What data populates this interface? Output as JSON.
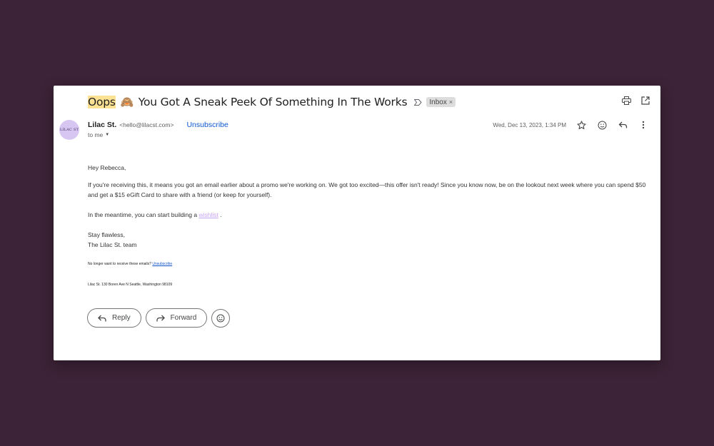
{
  "email": {
    "subject_highlight": "Oops",
    "subject_emoji": "🙈",
    "subject_rest": "You Got A Sneak Peek Of Something In The Works",
    "label": "Inbox",
    "sender_name": "Lilac St.",
    "sender_email": "<hello@lilacst.com>",
    "unsubscribe_label": "Unsubscribe",
    "to_label": "to me",
    "date": "Wed, Dec 13, 2023, 1:34 PM",
    "avatar_text": "LILAC ST"
  },
  "body": {
    "greeting": "Hey Rebecca,",
    "paragraph1": "If you're receiving this, it means you got an email earlier about a promo we're working on. We got too excited—this offer isn't ready! Since you know now, be on the lookout next week where you can spend $50 and get a $15 eGift Card to share with a friend (or keep for yourself).",
    "paragraph2_before": "In the meantime, you can start building a",
    "wishlist_link": "wishlist",
    "paragraph2_after": ".",
    "signoff1": "Stay flawless,",
    "signoff2": "The Lilac St. team",
    "footer_text": "No longer want to receive these emails?",
    "footer_link": "Unsubscribe",
    "address": "Lilac St. 130 Boren Ave N Seattle, Washington 98109"
  },
  "actions": {
    "reply_label": "Reply",
    "forward_label": "Forward"
  },
  "colors": {
    "background": "#3c2337",
    "highlight": "#fde293",
    "link_blue": "#0b57d0",
    "wishlist_lilac": "#c9a3f0",
    "avatar_bg": "#d8c6f2"
  }
}
